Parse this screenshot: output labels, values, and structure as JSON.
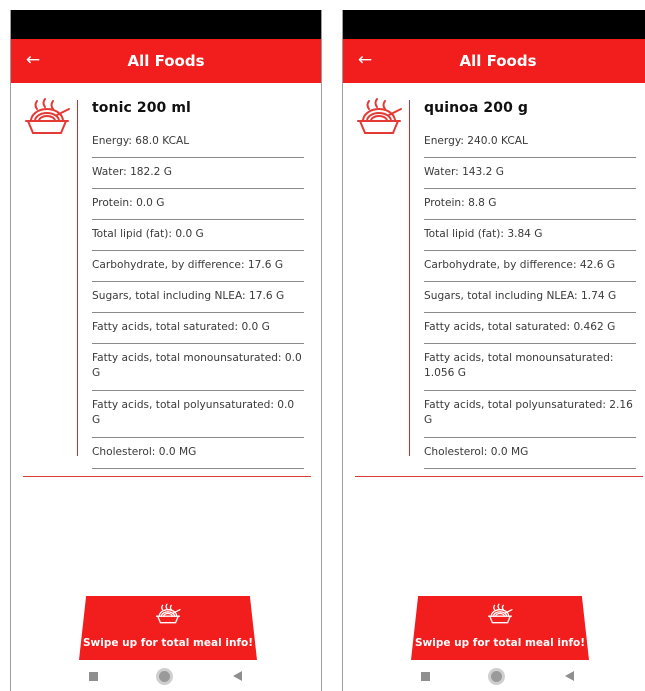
{
  "screens": [
    {
      "app_title": "All Foods",
      "back_glyph": "←",
      "food_icon": "noodle-bowl-icon",
      "food_title": "tonic 200 ml",
      "nutrients": [
        "Energy: 68.0 KCAL",
        "Water: 182.2 G",
        "Protein: 0.0 G",
        "Total lipid (fat): 0.0 G",
        "Carbohydrate, by difference: 17.6 G",
        "Sugars, total including NLEA: 17.6 G",
        "Fatty acids, total saturated: 0.0 G",
        "Fatty acids, total monounsaturated: 0.0 G",
        "Fatty acids, total polyunsaturated: 0.0 G",
        "Cholesterol: 0.0 MG"
      ],
      "swipe_text": "Swipe up for total meal info!"
    },
    {
      "app_title": "All Foods",
      "back_glyph": "←",
      "food_icon": "noodle-bowl-icon",
      "food_title": "quinoa 200 g",
      "nutrients": [
        "Energy: 240.0 KCAL",
        "Water: 143.2 G",
        "Protein: 8.8 G",
        "Total lipid (fat): 3.84 G",
        "Carbohydrate, by difference: 42.6 G",
        "Sugars, total including NLEA: 1.74 G",
        "Fatty acids, total saturated: 0.462 G",
        "Fatty acids, total monounsaturated: 1.056 G",
        "Fatty acids, total polyunsaturated: 2.16 G",
        "Cholesterol: 0.0 MG"
      ],
      "swipe_text": "Swipe up for total meal info!"
    }
  ],
  "colors": {
    "brand_red": "#f21d1d",
    "divider_red": "#d83a36",
    "status_bar": "#000000"
  },
  "nav_icons": [
    "recents-square-icon",
    "home-circle-icon",
    "back-triangle-icon"
  ]
}
